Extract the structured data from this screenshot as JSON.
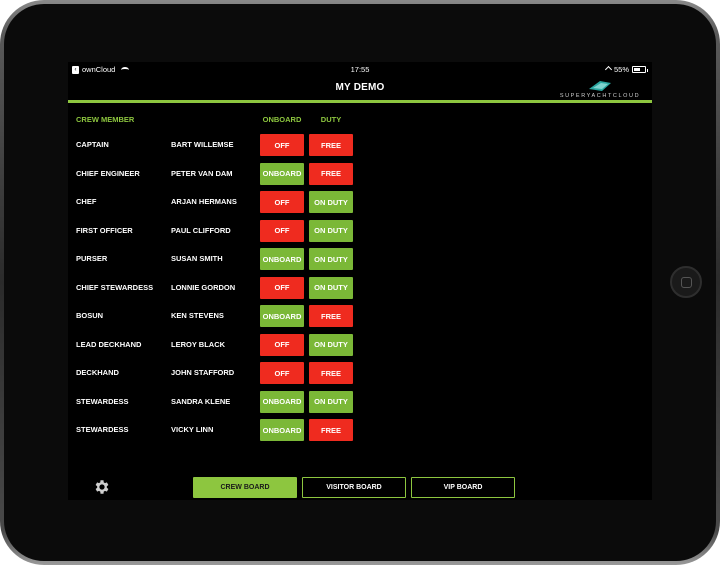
{
  "status": {
    "carrier": "ownCloud",
    "time": "17:55",
    "battery": "55%",
    "battery_level": 0.55
  },
  "app": {
    "title": "MY DEMO",
    "logo_text": "SUPERYACHTCLOUD"
  },
  "headers": {
    "crew_member": "CREW MEMBER",
    "onboard": "ONBOARD",
    "duty": "DUTY"
  },
  "crew": [
    {
      "role": "CAPTAIN",
      "name": "BART WILLEMSE",
      "onboard": "OFF",
      "duty": "FREE"
    },
    {
      "role": "CHIEF ENGINEER",
      "name": "PETER VAN DAM",
      "onboard": "ONBOARD",
      "duty": "FREE"
    },
    {
      "role": "CHEF",
      "name": "ARJAN HERMANS",
      "onboard": "OFF",
      "duty": "ON DUTY"
    },
    {
      "role": "FIRST OFFICER",
      "name": "PAUL CLIFFORD",
      "onboard": "OFF",
      "duty": "ON DUTY"
    },
    {
      "role": "PURSER",
      "name": "SUSAN SMITH",
      "onboard": "ONBOARD",
      "duty": "ON DUTY"
    },
    {
      "role": "CHIEF STEWARDESS",
      "name": "LONNIE GORDON",
      "onboard": "OFF",
      "duty": "ON DUTY"
    },
    {
      "role": "BOSUN",
      "name": "KEN STEVENS",
      "onboard": "ONBOARD",
      "duty": "FREE"
    },
    {
      "role": "LEAD DECKHAND",
      "name": "LEROY BLACK",
      "onboard": "OFF",
      "duty": "ON DUTY"
    },
    {
      "role": "DECKHAND",
      "name": "JOHN STAFFORD",
      "onboard": "OFF",
      "duty": "FREE"
    },
    {
      "role": "STEWARDESS",
      "name": "SANDRA KLENE",
      "onboard": "ONBOARD",
      "duty": "ON DUTY"
    },
    {
      "role": "STEWARDESS",
      "name": "VICKY LINN",
      "onboard": "ONBOARD",
      "duty": "FREE"
    }
  ],
  "tabs": [
    {
      "label": "CREW BOARD",
      "active": true
    },
    {
      "label": "VISITOR BOARD",
      "active": false
    },
    {
      "label": "VIP BOARD",
      "active": false
    }
  ],
  "icons": {
    "settings": "gear-icon",
    "logo": "yacht-wing-logo",
    "wifi": "wifi-icon",
    "location": "location-arrow-icon",
    "battery": "battery-icon"
  },
  "colors": {
    "accent": "#8dc63f",
    "status_on": "#7bb837",
    "status_off": "#ef2b1f",
    "background": "#000000"
  }
}
